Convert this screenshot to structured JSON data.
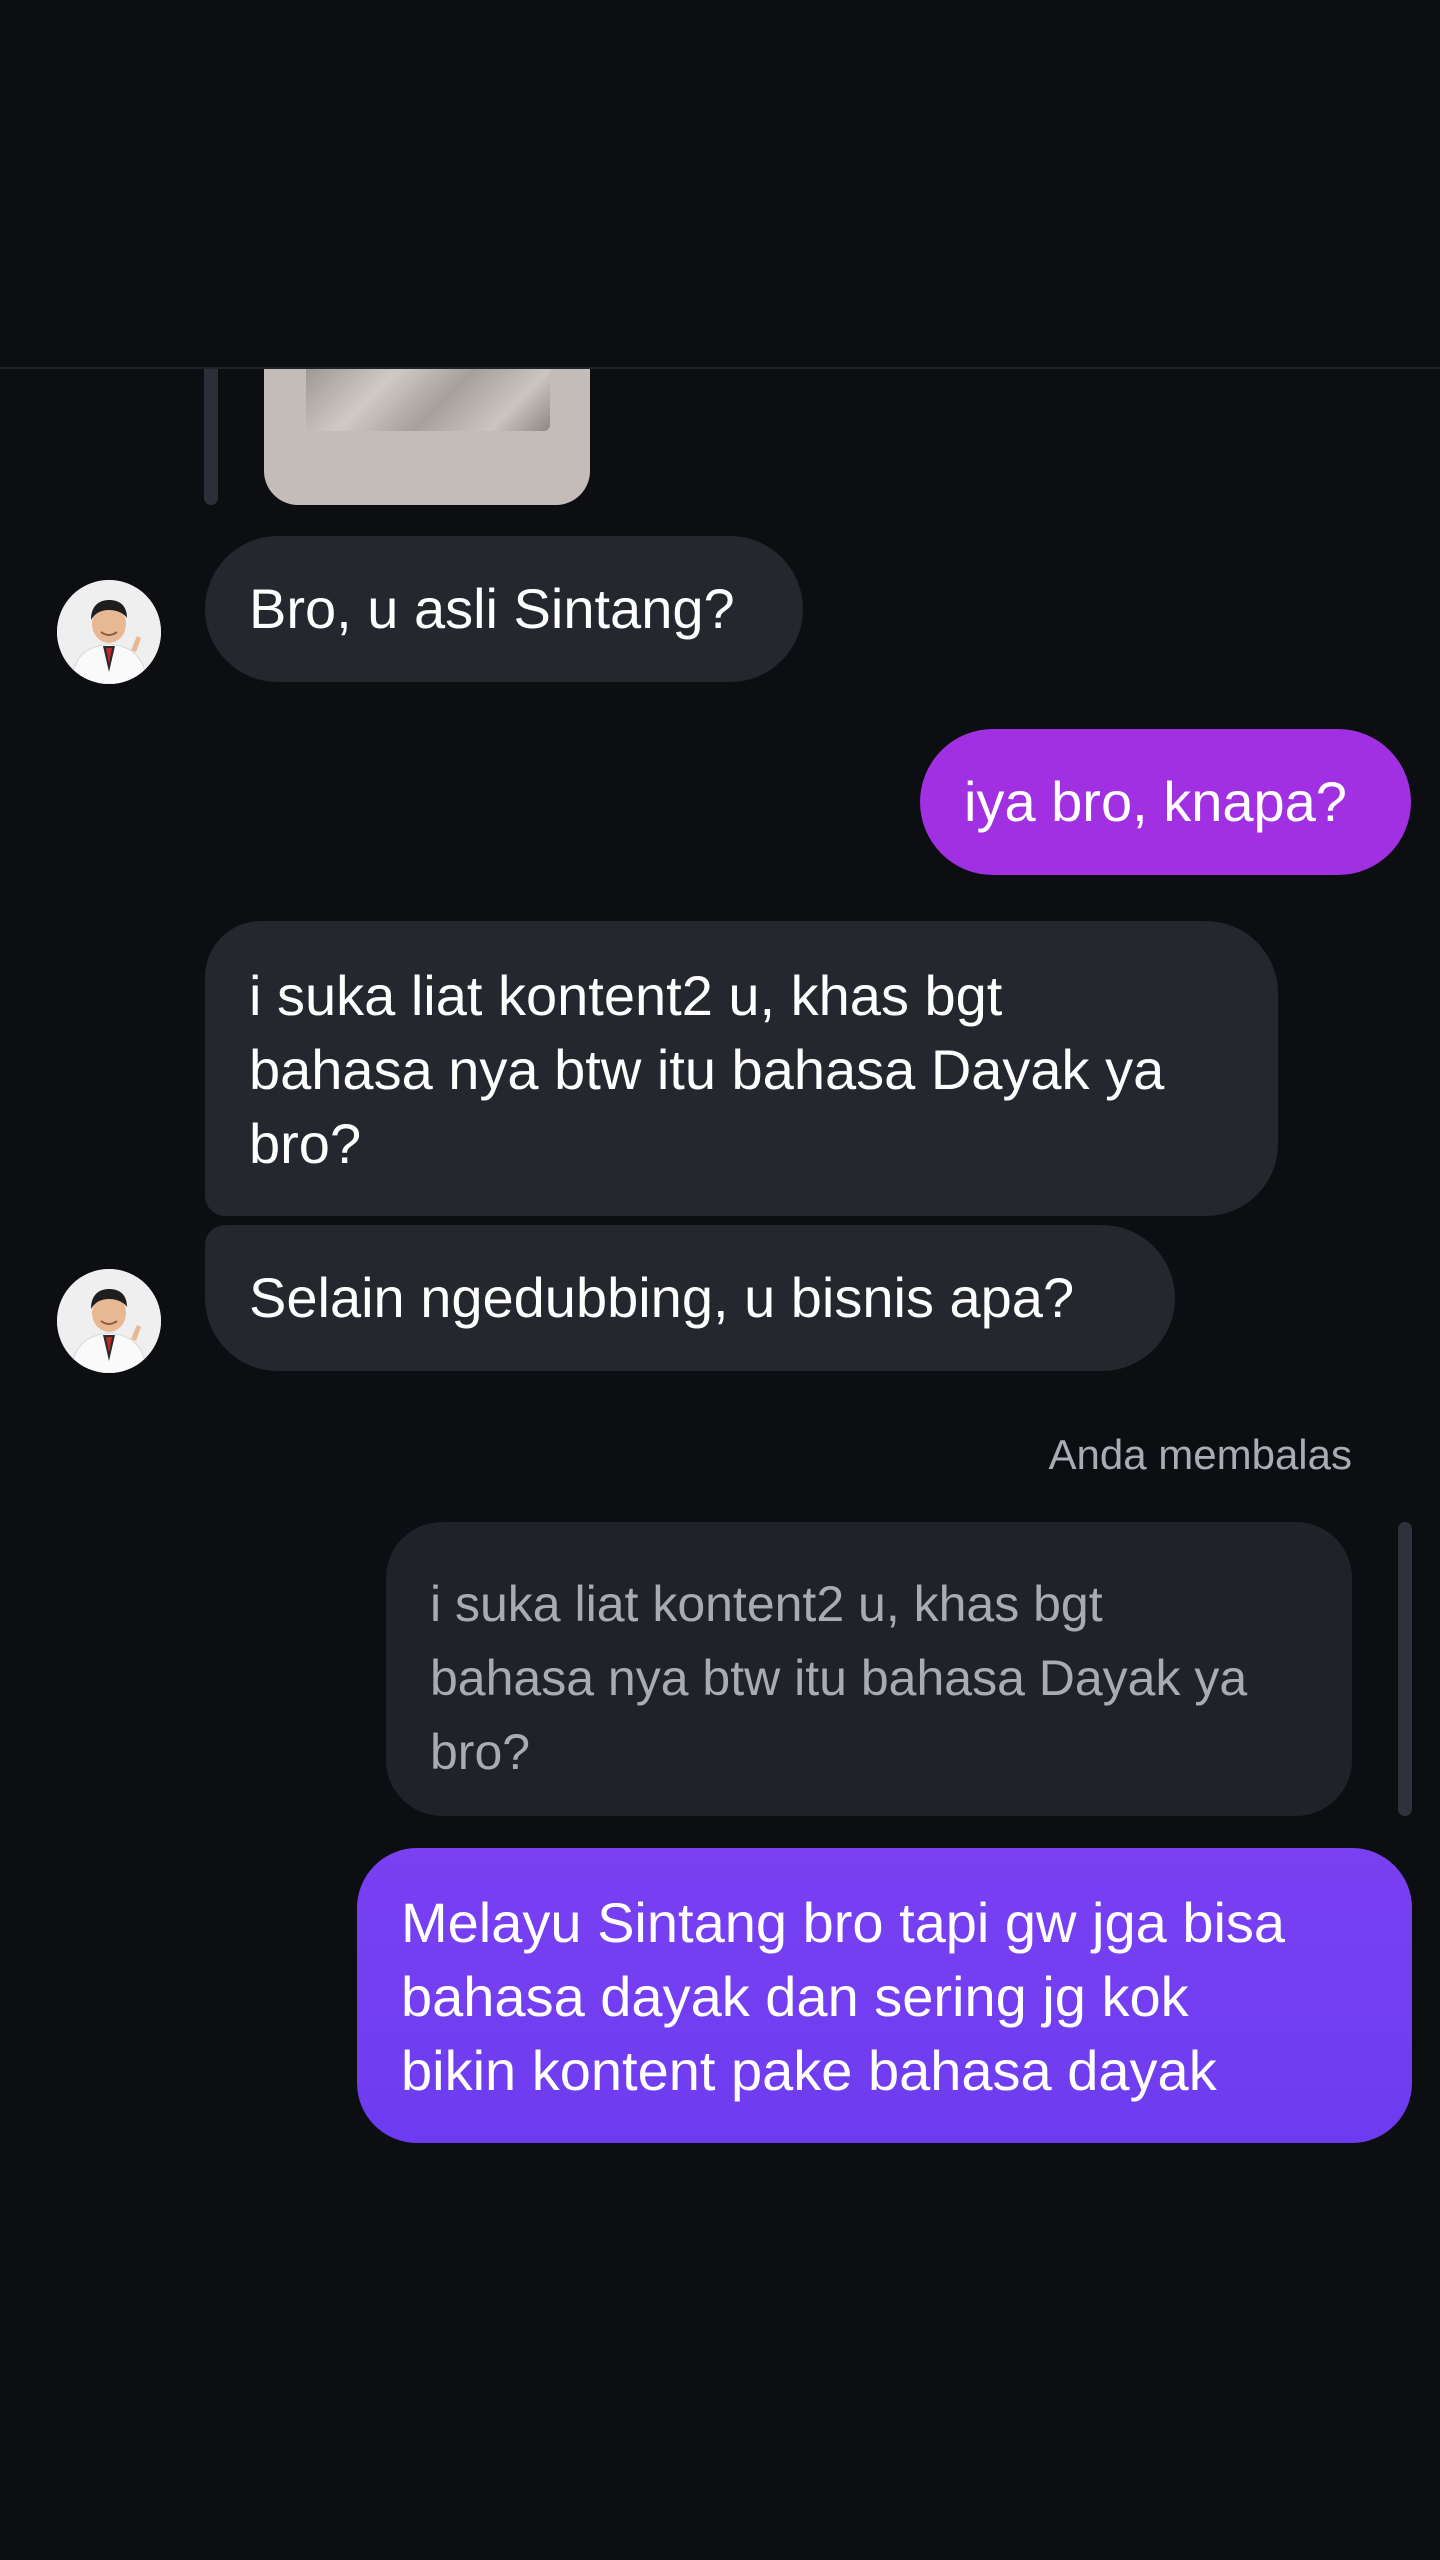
{
  "conversation": {
    "messages": [
      {
        "sender": "them",
        "lines": [
          "Bro, u asli Sintang?"
        ]
      },
      {
        "sender": "me",
        "lines": [
          "iya bro, knapa?"
        ]
      },
      {
        "sender": "them",
        "lines": [
          "i suka liat kontent2 u, khas bgt",
          "bahasa nya btw itu bahasa Dayak ya",
          "bro?"
        ]
      },
      {
        "sender": "them",
        "lines": [
          "Selain ngedubbing, u bisnis apa?"
        ]
      },
      {
        "sender": "me",
        "lines": [
          "Melayu Sintang bro tapi gw jga bisa",
          "bahasa dayak dan sering jg kok",
          "bikin kontent pake bahasa dayak"
        ]
      }
    ],
    "reply": {
      "label": "Anda membalas",
      "quoted_lines": [
        "i suka liat kontent2 u, khas bgt",
        "bahasa nya btw itu bahasa Dayak ya",
        "bro?"
      ]
    }
  },
  "colors": {
    "background": "#0c0e12",
    "incoming_bubble": "#24272e",
    "outgoing_magenta": "#a030e2",
    "outgoing_purple": "#7a40f2"
  },
  "icons": {
    "avatar": "contact-avatar"
  }
}
